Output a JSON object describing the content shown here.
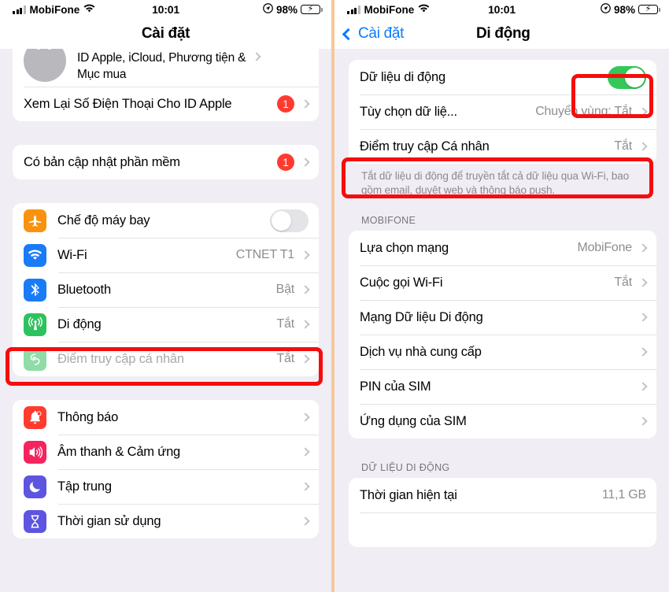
{
  "status_bar": {
    "carrier": "MobiFone",
    "time": "10:01",
    "battery_percent": "98%",
    "signal_icon": "cellular-bars-icon",
    "wifi_icon": "wifi-icon",
    "location_icon": "location-arrow-icon",
    "battery_icon": "battery-charging-icon"
  },
  "left_panel": {
    "nav": {
      "title": "Cài đặt"
    },
    "profile": {
      "line1": "ID Apple, iCloud, Phương tiện &",
      "line2": "Mục mua"
    },
    "review_row": {
      "label": "Xem Lại Số Điện Thoại Cho ID Apple",
      "badge": "1"
    },
    "update_row": {
      "label": "Có bản cập nhật phần mềm",
      "badge": "1"
    },
    "connectivity": [
      {
        "label": "Chế độ máy bay",
        "icon": "airplane-icon",
        "color": "#f9930f",
        "control": "toggle",
        "toggle_on": false
      },
      {
        "label": "Wi-Fi",
        "icon": "wifi-icon",
        "color": "#1a7bf6",
        "value": "CTNET T1"
      },
      {
        "label": "Bluetooth",
        "icon": "bluetooth-icon",
        "color": "#1a7bf6",
        "value": "Bật"
      },
      {
        "label": "Di động",
        "icon": "cellular-antenna-icon",
        "color": "#2ec25e",
        "value": "Tắt",
        "highlighted": true
      },
      {
        "label": "Điểm truy cập cá nhân",
        "icon": "hotspot-icon",
        "color": "#8fdca6",
        "value": "Tắt",
        "disabled": true
      }
    ],
    "system": [
      {
        "label": "Thông báo",
        "icon": "bell-icon",
        "color": "#ff3b30"
      },
      {
        "label": "Âm thanh & Cảm ứng",
        "icon": "speaker-icon",
        "color": "#f4245e"
      },
      {
        "label": "Tập trung",
        "icon": "moon-icon",
        "color": "#5d55e0"
      },
      {
        "label": "Thời gian sử dụng",
        "icon": "hourglass-icon",
        "color": "#5d55e0"
      }
    ]
  },
  "right_panel": {
    "nav": {
      "back_label": "Cài đặt",
      "title": "Di động",
      "back_icon": "chevron-left-icon"
    },
    "group1": [
      {
        "label": "Dữ liệu di động",
        "control": "toggle",
        "toggle_on": true,
        "highlighted": true
      },
      {
        "label": "Tùy chọn dữ liệ...",
        "value": "Chuyển vùng: Tắt"
      },
      {
        "label": "Điểm truy cập Cá nhân",
        "value": "Tắt",
        "highlighted": true
      }
    ],
    "footnote": "Tắt dữ liệu di động để truyền tắt cả dữ liệu qua Wi-Fi, bao gồm email, duyệt web và thông báo push.",
    "group2_header": "MOBIFONE",
    "group2": [
      {
        "label": "Lựa chọn mạng",
        "value": "MobiFone"
      },
      {
        "label": "Cuộc gọi Wi-Fi",
        "value": "Tắt"
      },
      {
        "label": "Mạng Dữ liệu Di động",
        "value": ""
      },
      {
        "label": "Dịch vụ nhà cung cấp",
        "value": ""
      },
      {
        "label": "PIN của SIM",
        "value": ""
      },
      {
        "label": "Ứng dụng của SIM",
        "value": ""
      }
    ],
    "group3_header": "DỮ LIỆU DI ĐỘNG",
    "group3": [
      {
        "label": "Thời gian hiện tại",
        "value": "11,1 GB"
      }
    ]
  },
  "colors": {
    "annotation": "#f50d0d",
    "accent_blue": "#0a7cff",
    "toggle_on": "#34c759",
    "divider_orange": "#f6c79a",
    "background": "#f0eef4"
  }
}
